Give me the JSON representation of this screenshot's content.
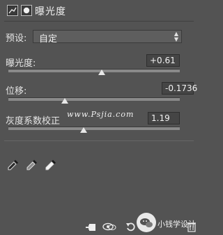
{
  "panel": {
    "title": "曝光度",
    "icons": [
      "adjustment-layer-icon",
      "mask-icon"
    ]
  },
  "preset": {
    "label": "预设:",
    "value": "自定"
  },
  "controls": {
    "exposure": {
      "label": "曝光度:",
      "value": "+0.61",
      "slider_fraction": 0.5
    },
    "offset": {
      "label": "位移:",
      "value": "-0.1736",
      "slider_fraction": 0.32
    },
    "gamma": {
      "label": "灰度系数校正",
      "value": "1.19",
      "slider_fraction": 0.45
    }
  },
  "watermark": "www.Psjia.com",
  "droppers": [
    "black-point-eyedropper-icon",
    "gray-point-eyedropper-icon",
    "white-point-eyedropper-icon"
  ],
  "bottom_bar": {
    "icons": [
      "clip-to-layer-icon",
      "visibility-icon",
      "reset-icon",
      "trash-icon"
    ],
    "brand": "小钱学设计"
  }
}
